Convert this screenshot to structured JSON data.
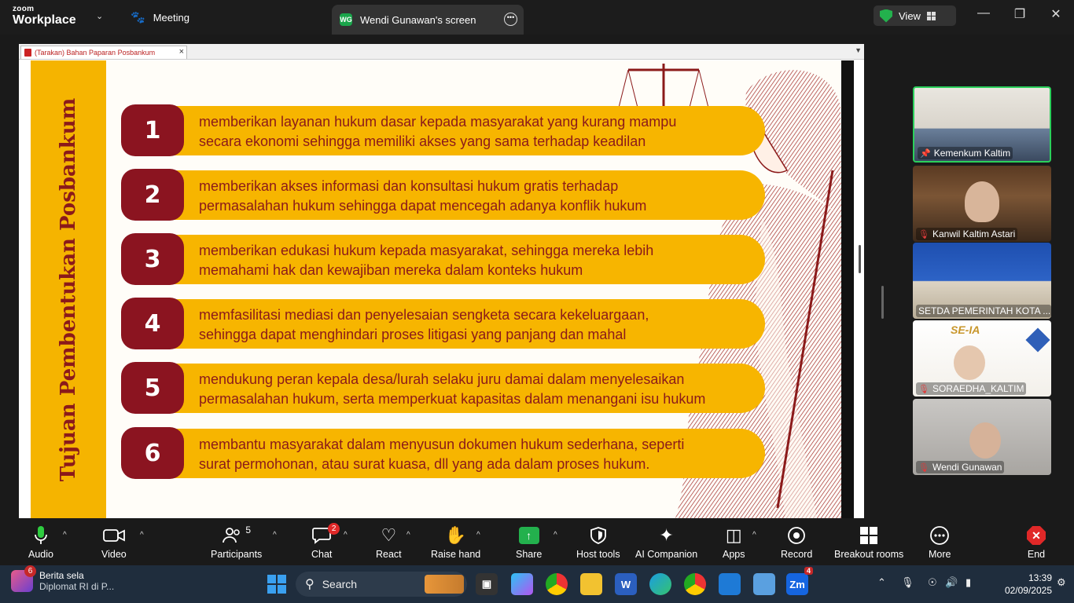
{
  "topbar": {
    "brand_small": "zoom",
    "brand_main": "Workplace",
    "meeting_tab": "Meeting",
    "screen_tab_initials": "WG",
    "screen_tab_title": "Wendi Gunawan's screen",
    "view_label": "View"
  },
  "document": {
    "tab_title": "(Tarakan) Bahan Paparan Posbankum",
    "slide_title": "Tujuan Pembentukan Posbankum",
    "items": [
      {
        "num": "1",
        "line1": "memberikan layanan hukum dasar kepada masyarakat yang kurang mampu",
        "line2": "secara ekonomi sehingga memiliki akses yang sama terhadap keadilan"
      },
      {
        "num": "2",
        "line1": "memberikan akses informasi dan konsultasi hukum gratis terhadap",
        "line2": "permasalahan hukum sehingga dapat mencegah adanya konflik hukum"
      },
      {
        "num": "3",
        "line1": "memberikan edukasi hukum kepada masyarakat, sehingga mereka lebih",
        "line2": "memahami hak dan kewajiban mereka dalam konteks hukum"
      },
      {
        "num": "4",
        "line1": "memfasilitasi mediasi dan penyelesaian sengketa secara kekeluargaan,",
        "line2": "sehingga dapat menghindari proses litigasi yang panjang dan mahal"
      },
      {
        "num": "5",
        "line1": "mendukung peran kepala desa/lurah selaku juru damai dalam menyelesaikan",
        "line2": "permasalahan hukum, serta memperkuat kapasitas dalam menangani isu hukum"
      },
      {
        "num": "6",
        "line1": "membantu masyarakat dalam menyusun dokumen hukum sederhana, seperti",
        "line2": "surat permohonan, atau surat kuasa, dll  yang ada dalam proses hukum."
      }
    ]
  },
  "participants": [
    {
      "name": "Kemenkum Kaltim",
      "icon": "pin-icon"
    },
    {
      "name": "Kanwil Kaltim Astari",
      "icon": "mic-off-icon"
    },
    {
      "name": "SETDA PEMERINTAH KOTA ...",
      "icon": ""
    },
    {
      "name": "SORAEDHA_KALTIM",
      "icon": "mic-off-icon"
    },
    {
      "name": "Wendi Gunawan",
      "icon": "mic-off-icon"
    }
  ],
  "toolbar": {
    "audio": "Audio",
    "video": "Video",
    "participants": "Participants",
    "participants_count": "5",
    "chat": "Chat",
    "chat_badge": "2",
    "react": "React",
    "raise_hand": "Raise hand",
    "share": "Share",
    "host_tools": "Host tools",
    "ai_companion": "AI Companion",
    "apps": "Apps",
    "record": "Record",
    "breakout": "Breakout rooms",
    "more": "More",
    "end": "End"
  },
  "taskbar": {
    "news_badge": "6",
    "news_title": "Berita sela",
    "news_sub": "Diplomat RI di P...",
    "search_placeholder": "Search",
    "zoom_badge": "4",
    "time": "13:39",
    "date": "02/09/2025"
  },
  "colors": {
    "slide_yellow": "#f7b500",
    "slide_maroon": "#8b1420",
    "active_speaker": "#2bd05b",
    "share_green": "#23b14d",
    "end_red": "#e02828"
  }
}
